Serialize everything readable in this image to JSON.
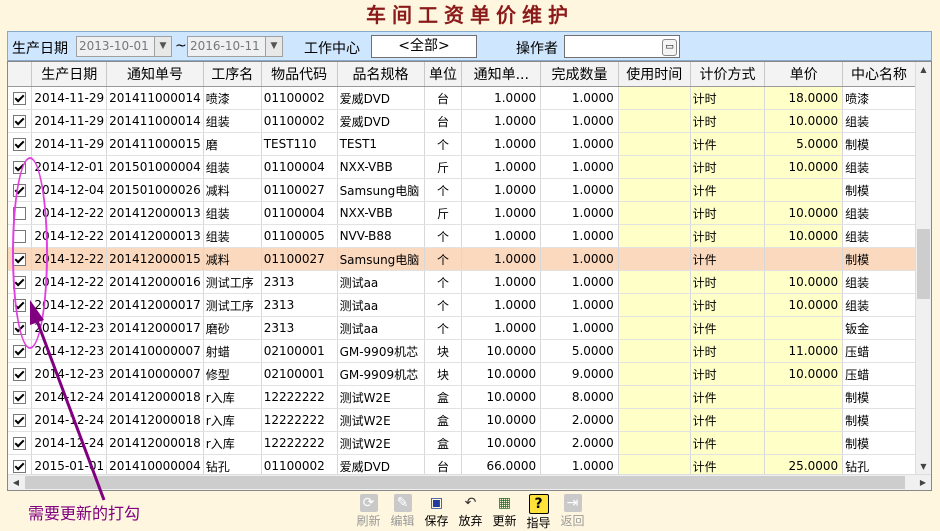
{
  "window": {
    "title": "车间工资单价维护"
  },
  "filters": {
    "date_label": "生产日期",
    "date_from": "2013-10-01",
    "date_sep": "~",
    "date_to": "2016-10-11",
    "work_center_label": "工作中心",
    "work_center_value": "<全部>",
    "operator_label": "操作者",
    "operator_value": ""
  },
  "grid": {
    "columns": [
      "",
      "生产日期",
      "通知单号",
      "工序名",
      "物品代码",
      "品名规格",
      "单位",
      "通知单...",
      "完成数量",
      "使用时间",
      "计价方式",
      "单价",
      "中心名称"
    ],
    "rows": [
      {
        "checked": true,
        "date": "2014-11-29",
        "notice_no": "201411000014",
        "process": "喷漆",
        "item_code": "01100002",
        "spec": "爱威DVD",
        "unit": "台",
        "notice_qty": "1.0000",
        "done_qty": "1.0000",
        "time": "",
        "pricing": "计时",
        "price": "18.0000",
        "center": "喷漆"
      },
      {
        "checked": true,
        "date": "2014-11-29",
        "notice_no": "201411000014",
        "process": "组装",
        "item_code": "01100002",
        "spec": "爱威DVD",
        "unit": "台",
        "notice_qty": "1.0000",
        "done_qty": "1.0000",
        "time": "",
        "pricing": "计时",
        "price": "10.0000",
        "center": "组装"
      },
      {
        "checked": true,
        "date": "2014-11-29",
        "notice_no": "201411000015",
        "process": "磨",
        "item_code": "TEST110",
        "spec": "TEST1",
        "unit": "个",
        "notice_qty": "1.0000",
        "done_qty": "1.0000",
        "time": "",
        "pricing": "计件",
        "price": "5.0000",
        "center": "制模"
      },
      {
        "checked": true,
        "date": "2014-12-01",
        "notice_no": "201501000004",
        "process": "组装",
        "item_code": "01100004",
        "spec": "NXX-VBB",
        "unit": "斤",
        "notice_qty": "1.0000",
        "done_qty": "1.0000",
        "time": "",
        "pricing": "计时",
        "price": "10.0000",
        "center": "组装"
      },
      {
        "checked": true,
        "date": "2014-12-04",
        "notice_no": "201501000026",
        "process": "减料",
        "item_code": "01100027",
        "spec": "Samsung电脑",
        "unit": "个",
        "notice_qty": "1.0000",
        "done_qty": "1.0000",
        "time": "",
        "pricing": "计件",
        "price": "",
        "center": "制模"
      },
      {
        "checked": false,
        "date": "2014-12-22",
        "notice_no": "201412000013",
        "process": "组装",
        "item_code": "01100004",
        "spec": "NXX-VBB",
        "unit": "斤",
        "notice_qty": "1.0000",
        "done_qty": "1.0000",
        "time": "",
        "pricing": "计时",
        "price": "10.0000",
        "center": "组装"
      },
      {
        "checked": false,
        "date": "2014-12-22",
        "notice_no": "201412000013",
        "process": "组装",
        "item_code": "01100005",
        "spec": "NVV-B88",
        "unit": "个",
        "notice_qty": "1.0000",
        "done_qty": "1.0000",
        "time": "",
        "pricing": "计时",
        "price": "10.0000",
        "center": "组装"
      },
      {
        "checked": true,
        "date": "2014-12-22",
        "notice_no": "201412000015",
        "process": "减料",
        "item_code": "01100027",
        "spec": "Samsung电脑",
        "unit": "个",
        "notice_qty": "1.0000",
        "done_qty": "1.0000",
        "time": "",
        "pricing": "计件",
        "price": "",
        "center": "制模",
        "selected": true
      },
      {
        "checked": true,
        "date": "2014-12-22",
        "notice_no": "201412000016",
        "process": "测试工序",
        "item_code": "2313",
        "spec": "测试aa",
        "unit": "个",
        "notice_qty": "1.0000",
        "done_qty": "1.0000",
        "time": "",
        "pricing": "计时",
        "price": "10.0000",
        "center": "组装"
      },
      {
        "checked": true,
        "date": "2014-12-22",
        "notice_no": "201412000017",
        "process": "测试工序",
        "item_code": "2313",
        "spec": "测试aa",
        "unit": "个",
        "notice_qty": "1.0000",
        "done_qty": "1.0000",
        "time": "",
        "pricing": "计时",
        "price": "10.0000",
        "center": "组装"
      },
      {
        "checked": true,
        "date": "2014-12-23",
        "notice_no": "201412000017",
        "process": "磨砂",
        "item_code": "2313",
        "spec": "测试aa",
        "unit": "个",
        "notice_qty": "1.0000",
        "done_qty": "1.0000",
        "time": "",
        "pricing": "计件",
        "price": "",
        "center": "钣金"
      },
      {
        "checked": true,
        "date": "2014-12-23",
        "notice_no": "201410000007",
        "process": "射蜡",
        "item_code": "02100001",
        "spec": "GM-9909机芯",
        "unit": "块",
        "notice_qty": "10.0000",
        "done_qty": "5.0000",
        "time": "",
        "pricing": "计时",
        "price": "11.0000",
        "center": "压蜡"
      },
      {
        "checked": true,
        "date": "2014-12-23",
        "notice_no": "201410000007",
        "process": "修型",
        "item_code": "02100001",
        "spec": "GM-9909机芯",
        "unit": "块",
        "notice_qty": "10.0000",
        "done_qty": "9.0000",
        "time": "",
        "pricing": "计时",
        "price": "10.0000",
        "center": "压蜡"
      },
      {
        "checked": true,
        "date": "2014-12-24",
        "notice_no": "201412000018",
        "process": "r入库",
        "item_code": "12222222",
        "spec": "测试W2E",
        "unit": "盒",
        "notice_qty": "10.0000",
        "done_qty": "8.0000",
        "time": "",
        "pricing": "计件",
        "price": "",
        "center": "制模"
      },
      {
        "checked": true,
        "date": "2014-12-24",
        "notice_no": "201412000018",
        "process": "r入库",
        "item_code": "12222222",
        "spec": "测试W2E",
        "unit": "盒",
        "notice_qty": "10.0000",
        "done_qty": "2.0000",
        "time": "",
        "pricing": "计件",
        "price": "",
        "center": "制模"
      },
      {
        "checked": true,
        "date": "2014-12-24",
        "notice_no": "201412000018",
        "process": "r入库",
        "item_code": "12222222",
        "spec": "测试W2E",
        "unit": "盒",
        "notice_qty": "10.0000",
        "done_qty": "2.0000",
        "time": "",
        "pricing": "计件",
        "price": "",
        "center": "制模"
      },
      {
        "checked": true,
        "date": "2015-01-01",
        "notice_no": "201410000004",
        "process": "钻孔",
        "item_code": "01100002",
        "spec": "爱威DVD",
        "unit": "台",
        "notice_qty": "66.0000",
        "done_qty": "1.0000",
        "time": "",
        "pricing": "计件",
        "price": "25.0000",
        "center": "钻孔"
      }
    ]
  },
  "annotation": {
    "text": "需要更新的打勾",
    "color": "#800080",
    "highlight_color": "#e040e0"
  },
  "toolbar": {
    "buttons": [
      {
        "label": "刷新",
        "icon": "refresh-icon",
        "glyph": "⟳",
        "enabled": false
      },
      {
        "label": "编辑",
        "icon": "edit-icon",
        "glyph": "✎",
        "enabled": false
      },
      {
        "label": "保存",
        "icon": "save-icon",
        "glyph": "▣",
        "enabled": true
      },
      {
        "label": "放弃",
        "icon": "undo-icon",
        "glyph": "↶",
        "enabled": true
      },
      {
        "label": "更新",
        "icon": "update-icon",
        "glyph": "▦",
        "enabled": true
      },
      {
        "label": "指导",
        "icon": "help-icon",
        "glyph": "?",
        "enabled": true
      },
      {
        "label": "返回",
        "icon": "exit-icon",
        "glyph": "⇥",
        "enabled": false
      }
    ]
  },
  "colors": {
    "accent": "#8b1a1a",
    "filter_bg": "#cfe6ff",
    "selected_row": "#fbd9bf",
    "yellow_cell": "#ffffc8"
  }
}
